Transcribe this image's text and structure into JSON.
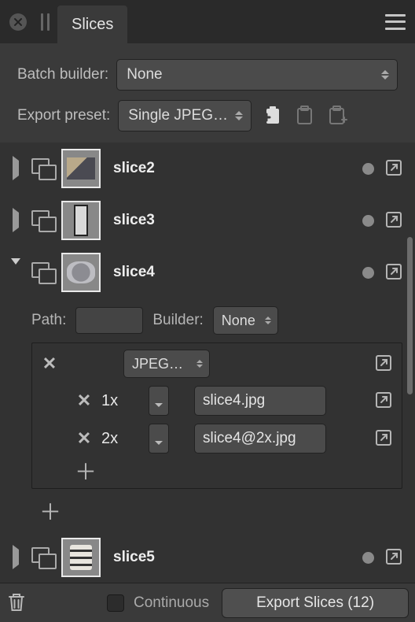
{
  "titlebar": {
    "tab": "Slices"
  },
  "batch": {
    "label": "Batch builder:",
    "value": "None"
  },
  "preset": {
    "label": "Export preset:",
    "value": "Single JPEG…"
  },
  "slices": [
    {
      "name": "slice2"
    },
    {
      "name": "slice3"
    },
    {
      "name": "slice4",
      "expanded": true,
      "path_label": "Path:",
      "builder_label": "Builder:",
      "builder_value": "None",
      "format_value": "JPEG…",
      "sizes": [
        {
          "scale": "1x",
          "filename": "slice4.jpg"
        },
        {
          "scale": "2x",
          "filename": "slice4@2x.jpg"
        }
      ]
    },
    {
      "name": "slice5"
    }
  ],
  "footer": {
    "continuous_label": "Continuous",
    "export_label": "Export Slices (12)"
  }
}
